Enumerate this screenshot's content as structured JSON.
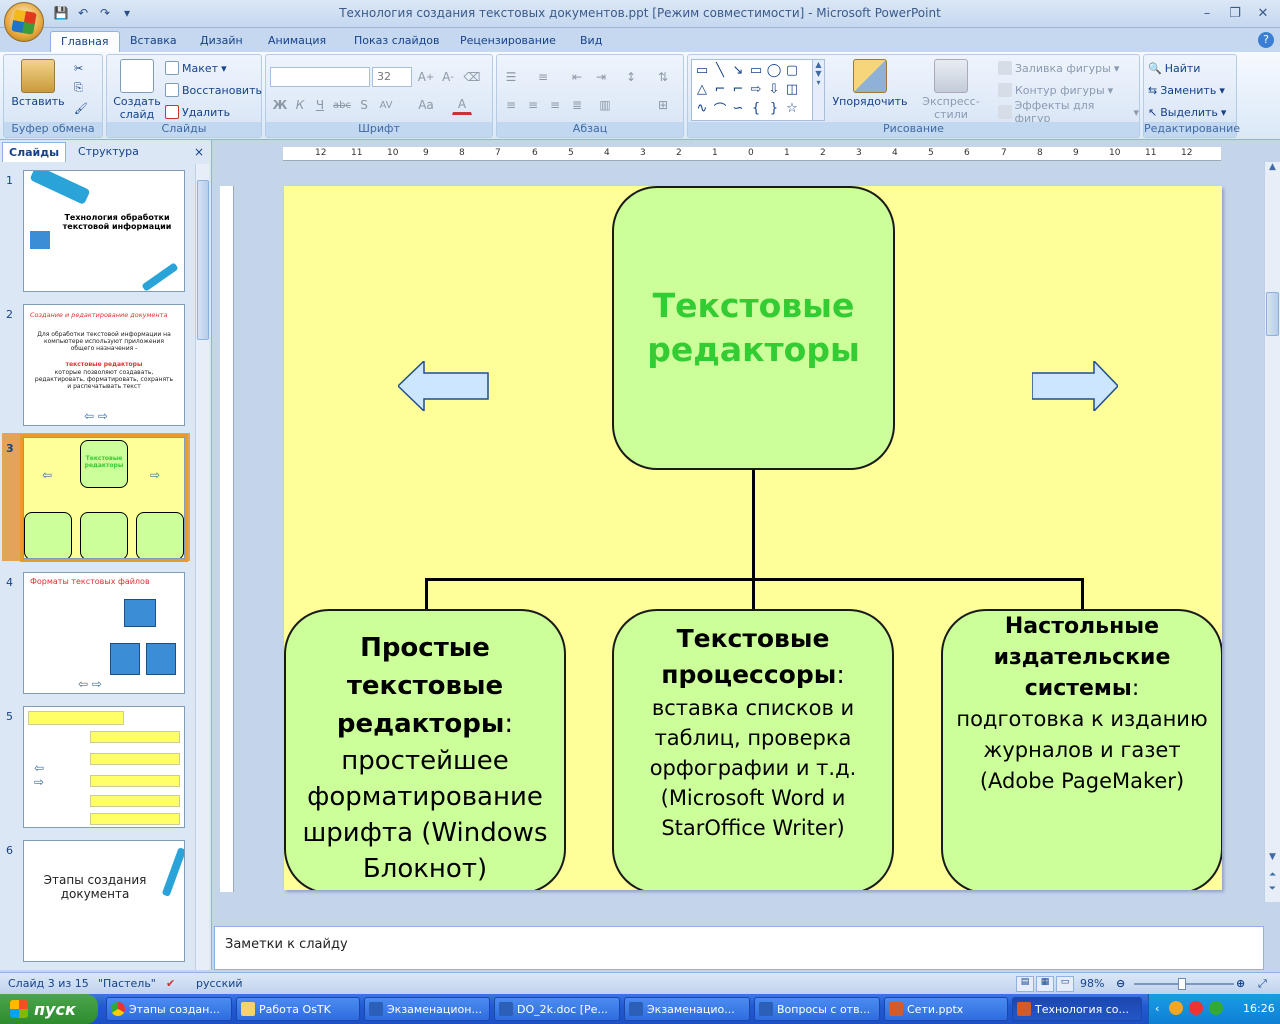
{
  "window": {
    "title": "Технология создания текстовых документов.ppt [Режим совместимости] - Microsoft PowerPoint",
    "controls": [
      "–",
      "❐",
      "✕"
    ]
  },
  "ribbon_tabs": [
    "Главная",
    "Вставка",
    "Дизайн",
    "Анимация",
    "Показ слайдов",
    "Рецензирование",
    "Вид"
  ],
  "ribbon": {
    "clipboard": {
      "label": "Буфер обмена",
      "paste": "Вставить"
    },
    "slides": {
      "label": "Слайды",
      "new_slide": "Создать слайд",
      "layout": "Макет",
      "reset": "Восстановить",
      "delete": "Удалить"
    },
    "font": {
      "label": "Шрифт",
      "size": "32"
    },
    "paragraph": {
      "label": "Абзац"
    },
    "drawing": {
      "label": "Рисование",
      "arrange": "Упорядочить",
      "quick_styles": "Экспресс-стили",
      "fill": "Заливка фигуры",
      "outline": "Контур фигуры",
      "effects": "Эффекты для фигур"
    },
    "editing": {
      "label": "Редактирование",
      "find": "Найти",
      "replace": "Заменить",
      "select": "Выделить"
    }
  },
  "left_panel": {
    "tabs": [
      "Слайды",
      "Структура"
    ],
    "close": "×",
    "slides": [
      {
        "num": "1",
        "text": "Технология обработки текстовой информации"
      },
      {
        "num": "2",
        "title": "Создание и редактирование документа",
        "body": "Для обработки текстовой информации на компьютере используют приложения общего назначения -",
        "highlight": "текстовые редакторы",
        "body2": "которые позволяют создавать, редактировать, форматировать, сохранять и распечатывать текст"
      },
      {
        "num": "3",
        "text": "Текстовые редакторы"
      },
      {
        "num": "4",
        "title": "Форматы текстовых файлов"
      },
      {
        "num": "5",
        "text": ""
      },
      {
        "num": "6",
        "text": "Этапы создания документа"
      }
    ]
  },
  "ruler": {
    "h_ticks": [
      "12",
      "11",
      "10",
      "9",
      "8",
      "7",
      "6",
      "5",
      "4",
      "3",
      "2",
      "1",
      "0",
      "1",
      "2",
      "3",
      "4",
      "5",
      "6",
      "7",
      "8",
      "9",
      "10",
      "11",
      "12"
    ]
  },
  "slide": {
    "top_box": "Текстовые редакторы",
    "left_box": {
      "title": "Простые текстовые редакторы",
      "colon": ":",
      "body": "простейшее форматирование шрифта (Windows Блокнот)"
    },
    "mid_box": {
      "title": "Текстовые процессоры",
      "colon": ":",
      "body": "вставка списков и таблиц, проверка орфографии и т.д. (Microsoft Word и StarOffice Writer)"
    },
    "right_box": {
      "title": "Настольные издательские системы",
      "colon": ":",
      "body": "подготовка к изданию журналов и газет (Adobe PageMaker)"
    },
    "colors": {
      "background": "#ffff99",
      "box_fill": "#ccff99",
      "title_green": "#33cc33",
      "arrow_fill": "#cce6ff"
    }
  },
  "notes": {
    "placeholder": "Заметки к слайду"
  },
  "status": {
    "slide_info": "Слайд 3 из 15",
    "theme": "\"Пастель\"",
    "language": "русский",
    "zoom": "98%"
  },
  "taskbar": {
    "start": "пуск",
    "tasks": [
      "Этапы создан...",
      "Работа OsTK",
      "Экзаменацион...",
      "DO_2k.doc [Ре...",
      "Экзаменацио...",
      "Вопросы с отв...",
      "Сети.pptx",
      "Технология со..."
    ],
    "lang": "RU",
    "time": "16:26"
  }
}
